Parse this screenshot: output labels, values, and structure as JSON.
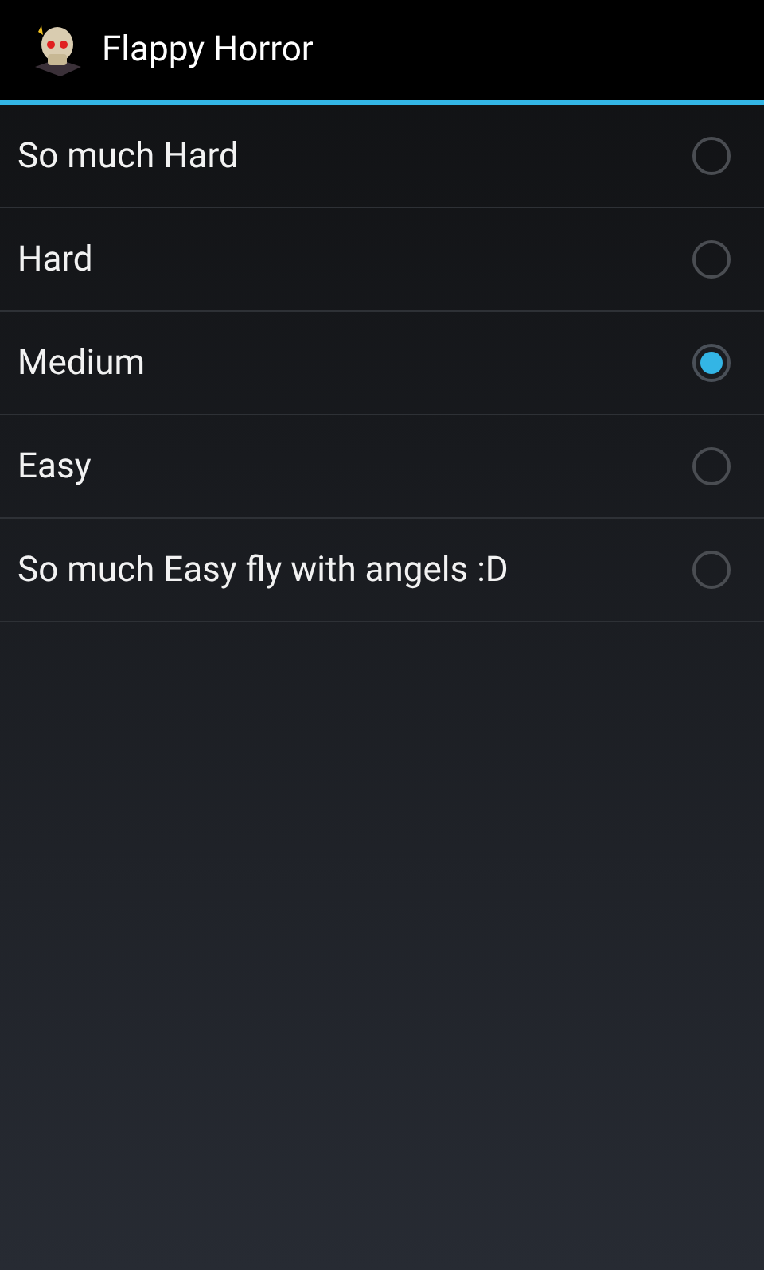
{
  "action_bar": {
    "title": "Flappy Horror"
  },
  "options": [
    {
      "label": "So much Hard",
      "selected": false
    },
    {
      "label": "Hard",
      "selected": false
    },
    {
      "label": "Medium",
      "selected": true
    },
    {
      "label": "Easy",
      "selected": false
    },
    {
      "label": "So much Easy fly with angels :D",
      "selected": false
    }
  ]
}
